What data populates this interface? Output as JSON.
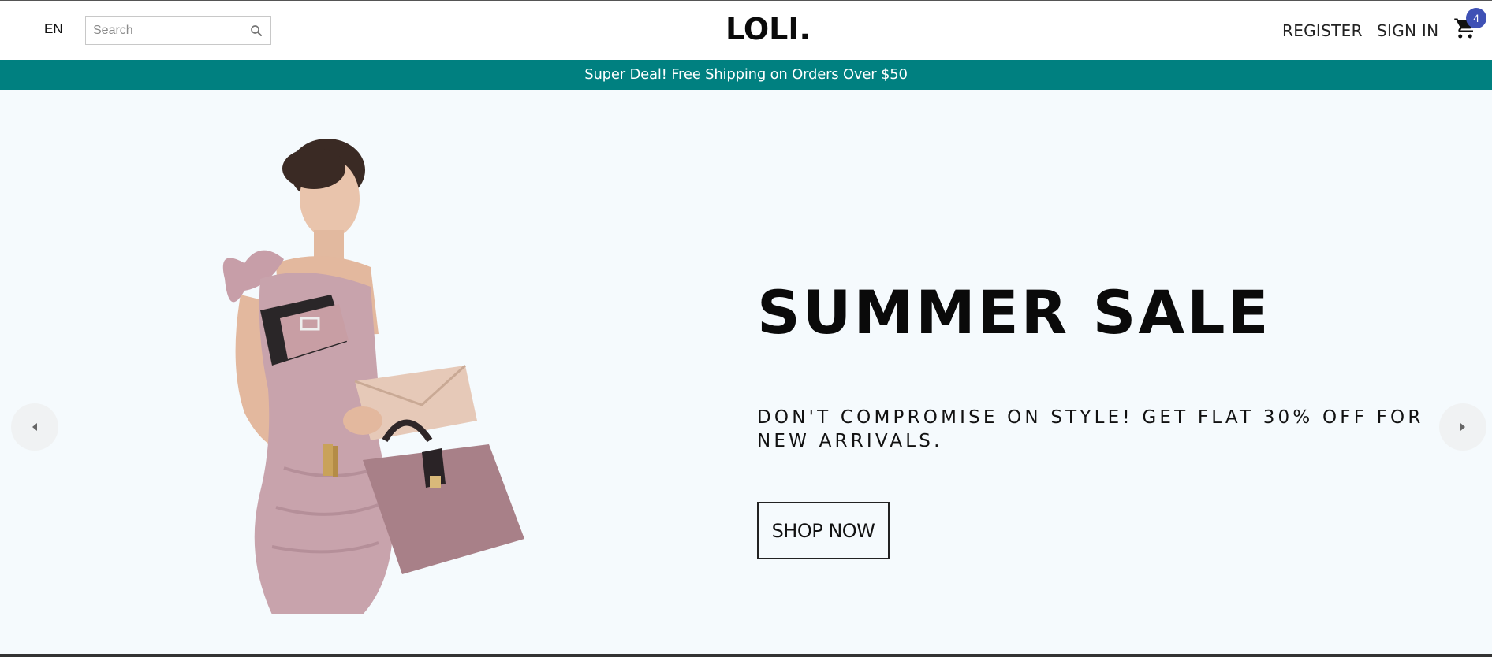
{
  "header": {
    "language": "EN",
    "search": {
      "placeholder": "Search",
      "value": "",
      "icon": "search-icon"
    },
    "logo": "LOLI.",
    "links": {
      "register": "REGISTER",
      "sign_in": "SIGN IN"
    },
    "cart": {
      "icon": "shopping-cart-icon",
      "count": "4",
      "badge_color": "#3f51b5"
    }
  },
  "announcement": {
    "text": "Super Deal! Free Shipping on Orders Over $50",
    "background": "#008080"
  },
  "hero": {
    "title": "SUMMER SALE",
    "description": "DON'T COMPROMISE ON STYLE! GET FLAT 30% OFF FOR NEW ARRIVALS.",
    "button_label": "SHOP NOW",
    "background": "#f5fafd",
    "image": "woman-with-handbags-image",
    "prev_icon": "arrow-left-icon",
    "next_icon": "arrow-right-icon"
  }
}
